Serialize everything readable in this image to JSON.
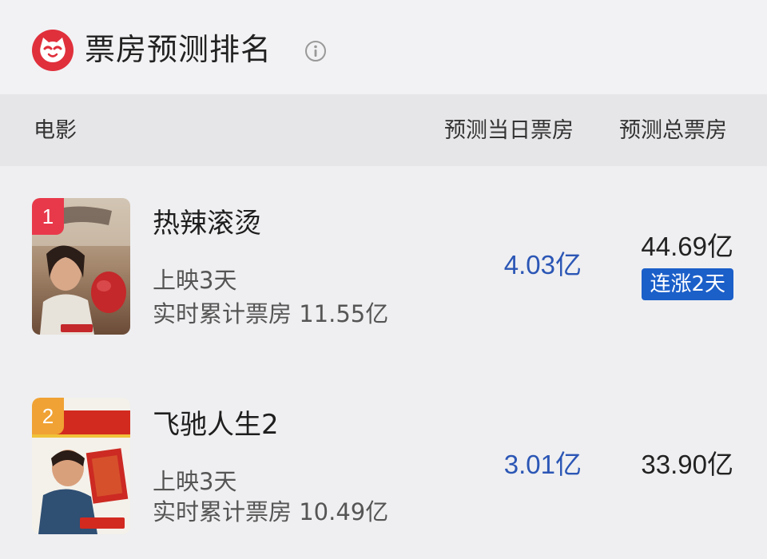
{
  "header": {
    "title": "票房预测排名",
    "logo_icon": "maoyan-cat-logo-icon",
    "info_icon": "info-icon"
  },
  "table": {
    "col_movie": "电影",
    "col_today": "预测当日票房",
    "col_total": "预测总票房"
  },
  "movies": [
    {
      "rank": "1",
      "rank_color": "#e8394a",
      "name": "热辣滚烫",
      "days": "上映3天",
      "cumulative": "实时累计票房 11.55亿",
      "today": "4.03亿",
      "total": "44.69亿",
      "badge": "连涨2天"
    },
    {
      "rank": "2",
      "rank_color": "#f0a234",
      "name": "飞驰人生2",
      "days": "上映3天",
      "cumulative": "实时累计票房 10.49亿",
      "today": "3.01亿",
      "total": "33.90亿"
    }
  ],
  "colors": {
    "accent_blue": "#2b56b5",
    "badge_blue": "#1b5fc9",
    "brand_red": "#e0303c"
  }
}
